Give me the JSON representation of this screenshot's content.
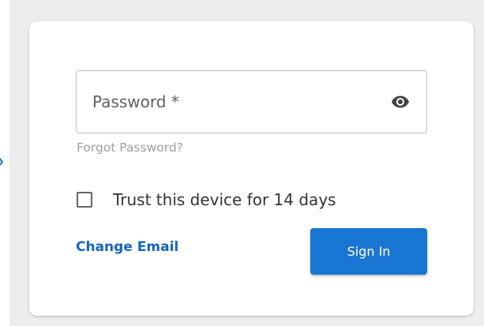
{
  "login": {
    "password": {
      "placeholder": "Password *",
      "value": "",
      "visibility_icon": "eye-icon"
    },
    "forgot_password_label": "Forgot Password?",
    "trust_device": {
      "label": "Trust this device for 14 days",
      "checked": false
    },
    "change_email_label": "Change Email",
    "sign_in_label": "Sign In"
  },
  "colors": {
    "page_background": "#ededed",
    "card_background": "#ffffff",
    "primary": "#1976d2",
    "link": "#1565c0",
    "muted_text": "#9e9e9e"
  }
}
